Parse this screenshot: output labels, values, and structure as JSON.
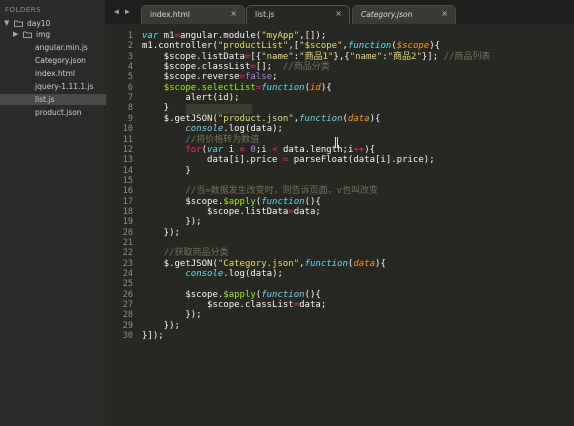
{
  "sidebar": {
    "header": "FOLDERS",
    "root": "day10",
    "items": [
      {
        "label": "img",
        "type": "folder"
      },
      {
        "label": "angular.min.js",
        "type": "file"
      },
      {
        "label": "Category.json",
        "type": "file"
      },
      {
        "label": "index.html",
        "type": "file"
      },
      {
        "label": "jquery-1.11.1.js",
        "type": "file"
      },
      {
        "label": "list.js",
        "type": "file",
        "selected": true
      },
      {
        "label": "product.json",
        "type": "file"
      }
    ]
  },
  "tabs": [
    {
      "label": "index.html",
      "active": false,
      "close": "×"
    },
    {
      "label": "list.js",
      "active": true,
      "close": "×"
    },
    {
      "label": "Category.json",
      "active": false,
      "close": "×"
    }
  ],
  "editor": {
    "current_line": 7,
    "lines": [
      [
        [
          "k",
          "var"
        ],
        [
          "t",
          " m1"
        ],
        [
          "st",
          "="
        ],
        [
          "t",
          "angular.module("
        ],
        [
          "s",
          "\"myApp\""
        ],
        [
          "t",
          ",[]);"
        ]
      ],
      [
        [
          "t",
          "m1.controller("
        ],
        [
          "s",
          "\"productList\""
        ],
        [
          "t",
          ",["
        ],
        [
          "s",
          "\"$scope\""
        ],
        [
          "t",
          ","
        ],
        [
          "k",
          "function"
        ],
        [
          "t",
          "("
        ],
        [
          "p",
          "$scope"
        ],
        [
          "t",
          "){"
        ]
      ],
      [
        [
          "t",
          "    $scope.listData"
        ],
        [
          "st",
          "="
        ],
        [
          "t",
          "[{"
        ],
        [
          "s",
          "\"name\""
        ],
        [
          "t",
          ":"
        ],
        [
          "s",
          "\"商品1\""
        ],
        [
          "t",
          "},{"
        ],
        [
          "s",
          "\"name\""
        ],
        [
          "t",
          ":"
        ],
        [
          "s",
          "\"商品2\""
        ],
        [
          "t",
          "}]; "
        ],
        [
          "c",
          "//商品列表"
        ]
      ],
      [
        [
          "t",
          "    $scope.classList"
        ],
        [
          "st",
          "="
        ],
        [
          "t",
          "[];  "
        ],
        [
          "c",
          "//商品分类"
        ]
      ],
      [
        [
          "t",
          "    $scope.reverse"
        ],
        [
          "st",
          "="
        ],
        [
          "n",
          "false"
        ],
        [
          "t",
          ";"
        ]
      ],
      [
        [
          "t",
          "    "
        ],
        [
          "f",
          "$scope.selectList"
        ],
        [
          "st",
          "="
        ],
        [
          "k",
          "function"
        ],
        [
          "t",
          "("
        ],
        [
          "p",
          "id"
        ],
        [
          "t",
          "){"
        ]
      ],
      [
        [
          "t",
          "        alert(id);"
        ]
      ],
      [
        [
          "t",
          "    }"
        ]
      ],
      [
        [
          "t",
          "    $.getJSON("
        ],
        [
          "s",
          "\"product.json\""
        ],
        [
          "t",
          ","
        ],
        [
          "k",
          "function"
        ],
        [
          "t",
          "("
        ],
        [
          "p",
          "data"
        ],
        [
          "t",
          "){"
        ]
      ],
      [
        [
          "t",
          "        "
        ],
        [
          "k",
          "console"
        ],
        [
          "t",
          ".log(data);"
        ]
      ],
      [
        [
          "t",
          "        "
        ],
        [
          "c",
          "//将价格转为数值"
        ]
      ],
      [
        [
          "t",
          "        "
        ],
        [
          "st",
          "for"
        ],
        [
          "t",
          "("
        ],
        [
          "k",
          "var"
        ],
        [
          "t",
          " i "
        ],
        [
          "st",
          "="
        ],
        [
          "t",
          " "
        ],
        [
          "n",
          "0"
        ],
        [
          "t",
          ";i "
        ],
        [
          "st",
          "<"
        ],
        [
          "t",
          " data.length;i"
        ],
        [
          "st",
          "++"
        ],
        [
          "t",
          "){"
        ]
      ],
      [
        [
          "t",
          "            data[i].price "
        ],
        [
          "st",
          "="
        ],
        [
          "t",
          " parseFloat(data[i].price);"
        ]
      ],
      [
        [
          "t",
          "        }"
        ]
      ],
      [
        [
          "t",
          ""
        ]
      ],
      [
        [
          "t",
          "        "
        ],
        [
          "c",
          "//当=数据发生改变时，则告诉页面，v也叫改变"
        ]
      ],
      [
        [
          "t",
          "        $scope."
        ],
        [
          "f",
          "$apply"
        ],
        [
          "t",
          "("
        ],
        [
          "k",
          "function"
        ],
        [
          "t",
          "(){"
        ]
      ],
      [
        [
          "t",
          "            $scope.listData"
        ],
        [
          "st",
          "="
        ],
        [
          "t",
          "data;"
        ]
      ],
      [
        [
          "t",
          "        });"
        ]
      ],
      [
        [
          "t",
          "    });"
        ]
      ],
      [
        [
          "t",
          ""
        ]
      ],
      [
        [
          "t",
          "    "
        ],
        [
          "c",
          "//获取商品分类"
        ]
      ],
      [
        [
          "t",
          "    $.getJSON("
        ],
        [
          "s",
          "\"Category.json\""
        ],
        [
          "t",
          ","
        ],
        [
          "k",
          "function"
        ],
        [
          "t",
          "("
        ],
        [
          "p",
          "data"
        ],
        [
          "t",
          "){"
        ]
      ],
      [
        [
          "t",
          "        "
        ],
        [
          "k",
          "console"
        ],
        [
          "t",
          ".log(data);"
        ]
      ],
      [
        [
          "t",
          ""
        ]
      ],
      [
        [
          "t",
          "        $scope."
        ],
        [
          "f",
          "$apply"
        ],
        [
          "t",
          "("
        ],
        [
          "k",
          "function"
        ],
        [
          "t",
          "(){"
        ]
      ],
      [
        [
          "t",
          "            $scope.classList"
        ],
        [
          "st",
          "="
        ],
        [
          "t",
          "data;"
        ]
      ],
      [
        [
          "t",
          "        });"
        ]
      ],
      [
        [
          "t",
          "    });"
        ]
      ],
      [
        [
          "t",
          "}]);"
        ]
      ]
    ]
  }
}
